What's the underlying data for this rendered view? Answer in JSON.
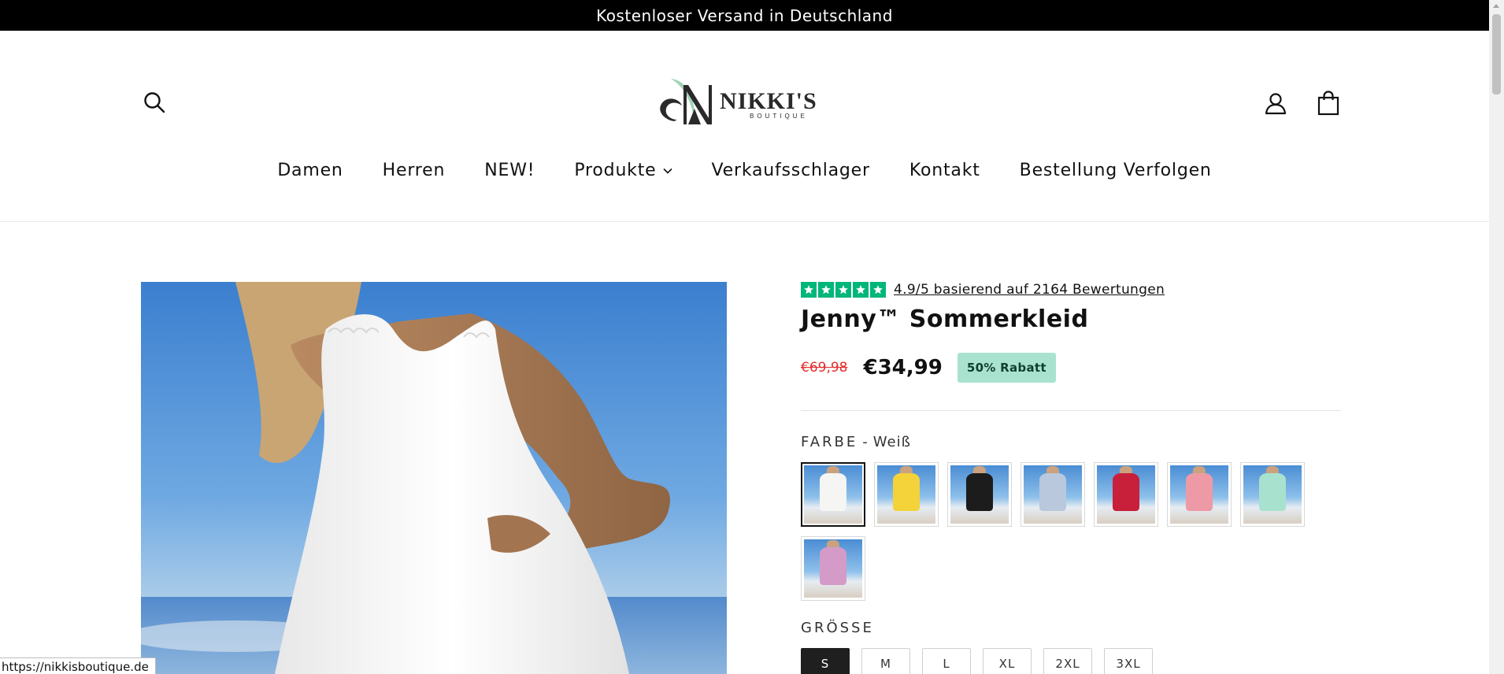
{
  "announcement": "Kostenloser Versand in Deutschland",
  "header": {
    "logo_text": "NIKKI'S",
    "logo_subtext": "BOUTIQUE",
    "icons": [
      "search-icon",
      "account-icon",
      "cart-icon"
    ]
  },
  "nav": {
    "items": [
      {
        "label": "Damen"
      },
      {
        "label": "Herren"
      },
      {
        "label": "NEW!"
      },
      {
        "label": "Produkte",
        "has_dropdown": true
      },
      {
        "label": "Verkaufsschlager"
      },
      {
        "label": "Kontakt"
      },
      {
        "label": "Bestellung Verfolgen"
      }
    ]
  },
  "product": {
    "rating_text": "4.9/5 basierend auf 2164 Bewertungen",
    "title": "Jenny™ Sommerkleid",
    "price_old": "€69,98",
    "price_new": "€34,99",
    "discount": "50% Rabatt",
    "color": {
      "label": "FARBE",
      "separator": "-",
      "selected": "Weiß",
      "swatches": [
        {
          "name": "white",
          "color": "#f5f5f3",
          "selected": true
        },
        {
          "name": "yellow",
          "color": "#f3d23a"
        },
        {
          "name": "black",
          "color": "#1c1c1c"
        },
        {
          "name": "light-blue",
          "color": "#b9c8dc"
        },
        {
          "name": "red",
          "color": "#c8203a"
        },
        {
          "name": "pink",
          "color": "#ee9aa6"
        },
        {
          "name": "mint",
          "color": "#a8e2cf"
        },
        {
          "name": "lilac",
          "color": "#d49bc8"
        }
      ]
    },
    "size": {
      "label": "GRÖSSE",
      "options": [
        "S",
        "M",
        "L",
        "XL",
        "2XL",
        "3XL"
      ],
      "selected": "S"
    }
  },
  "status_url": "https://nikkisboutique.de",
  "colors": {
    "accent_green": "#00b67a",
    "sale_red": "#e32b2b",
    "badge_bg": "#a9e3cf"
  }
}
